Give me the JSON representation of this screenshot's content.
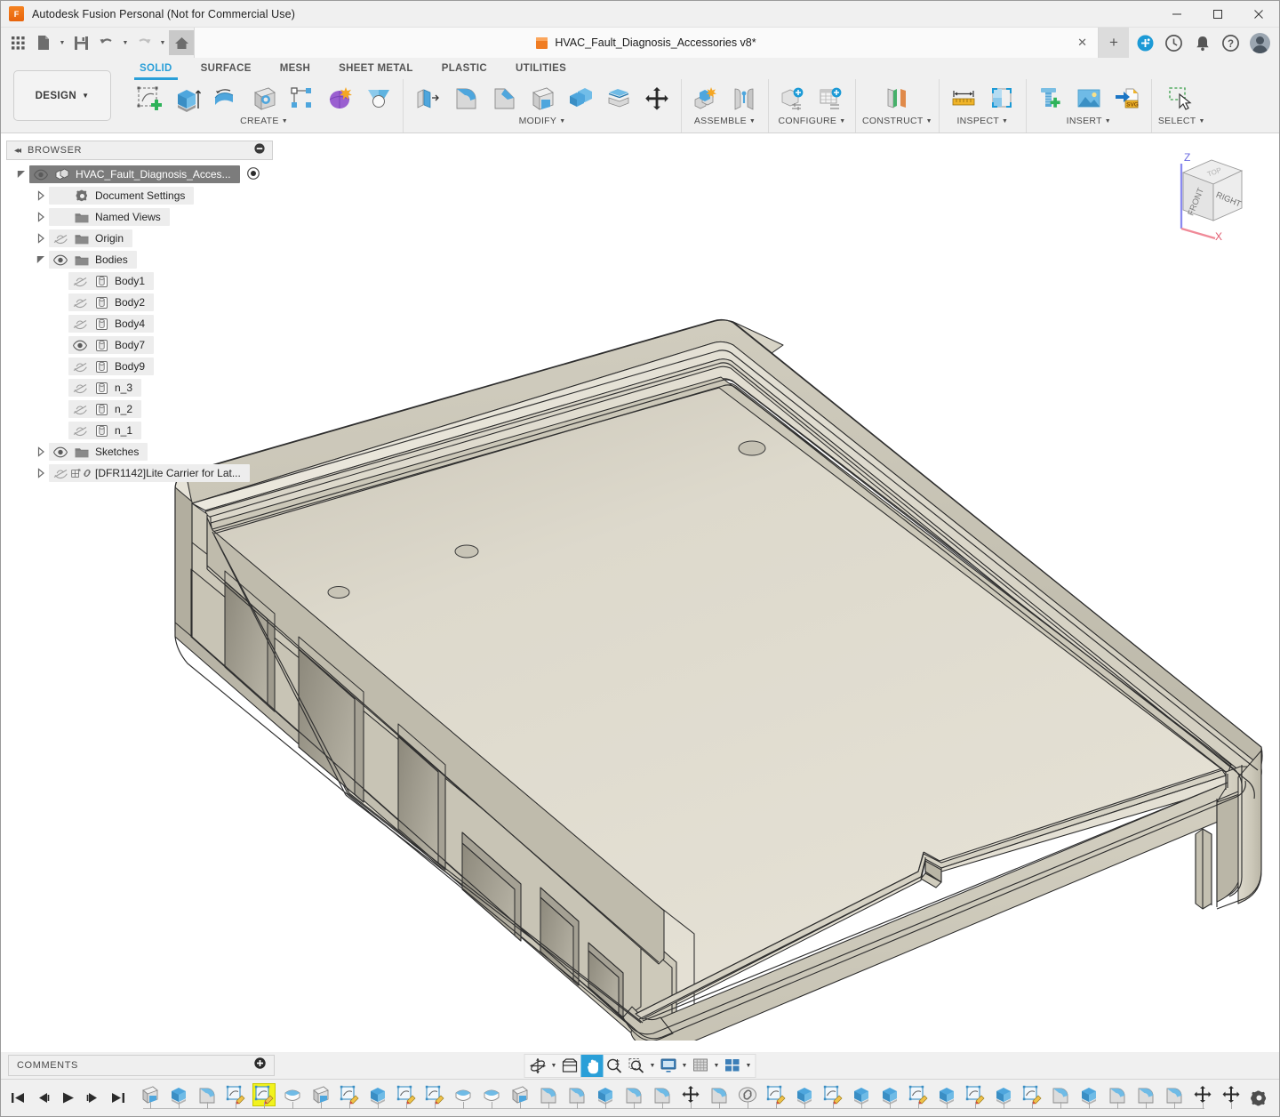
{
  "window": {
    "title": "Autodesk Fusion Personal (Not for Commercial Use)",
    "logo_letter": "F",
    "minimize": "—",
    "maximize": "▢",
    "close": "✕"
  },
  "quick_access": {
    "items": [
      {
        "name": "app-grid-icon",
        "label": "Show Data Panel"
      },
      {
        "name": "file-icon",
        "label": "File"
      },
      {
        "name": "save-icon",
        "label": "Save"
      },
      {
        "name": "undo-icon",
        "label": "Undo"
      },
      {
        "name": "redo-icon",
        "label": "Redo"
      },
      {
        "name": "home-icon",
        "label": "Home"
      }
    ]
  },
  "document_tab": {
    "label": "HVAC_Fault_Diagnosis_Accessories v8*",
    "close_label": "✕",
    "new_tab_label": "+"
  },
  "tray": {
    "items": [
      {
        "name": "extension-manager-icon",
        "label": "Extensions"
      },
      {
        "name": "job-status-icon",
        "label": "Job Status"
      },
      {
        "name": "notifications-bell-icon",
        "label": "Notifications"
      },
      {
        "name": "help-icon",
        "label": "Help"
      },
      {
        "name": "account-avatar",
        "label": "Account"
      }
    ]
  },
  "ribbon": {
    "design_button": "DESIGN",
    "tabs": [
      {
        "label": "SOLID",
        "active": true
      },
      {
        "label": "SURFACE",
        "active": false
      },
      {
        "label": "MESH",
        "active": false
      },
      {
        "label": "SHEET METAL",
        "active": false
      },
      {
        "label": "PLASTIC",
        "active": false
      },
      {
        "label": "UTILITIES",
        "active": false
      }
    ],
    "groups": [
      {
        "label": "CREATE",
        "has_dropdown": true,
        "tools": [
          {
            "name": "create-sketch-icon",
            "label": "Create Sketch"
          },
          {
            "name": "extrude-icon",
            "label": "Extrude"
          },
          {
            "name": "revolve-icon",
            "label": "Revolve"
          },
          {
            "name": "hole-icon",
            "label": "Hole"
          },
          {
            "name": "rectangular-pattern-icon",
            "label": "Rectangular Pattern"
          },
          {
            "name": "form-icon",
            "label": "Create Form"
          },
          {
            "name": "derive-icon",
            "label": "Derive"
          }
        ]
      },
      {
        "label": "MODIFY",
        "has_dropdown": true,
        "tools": [
          {
            "name": "press-pull-icon",
            "label": "Press Pull"
          },
          {
            "name": "fillet-icon",
            "label": "Fillet"
          },
          {
            "name": "chamfer-icon",
            "label": "Chamfer"
          },
          {
            "name": "shell-icon",
            "label": "Shell"
          },
          {
            "name": "combine-icon",
            "label": "Combine"
          },
          {
            "name": "split-face-icon",
            "label": "Split Face"
          },
          {
            "name": "move-copy-icon",
            "label": "Move/Copy"
          }
        ]
      },
      {
        "label": "ASSEMBLE",
        "has_dropdown": true,
        "tools": [
          {
            "name": "new-component-icon",
            "label": "New Component"
          },
          {
            "name": "joint-icon",
            "label": "Joint"
          }
        ]
      },
      {
        "label": "CONFIGURE",
        "has_dropdown": true,
        "tools": [
          {
            "name": "create-configuration-icon",
            "label": "Create Configuration"
          },
          {
            "name": "configuration-table-icon",
            "label": "Configuration Table"
          }
        ]
      },
      {
        "label": "CONSTRUCT",
        "has_dropdown": true,
        "tools": [
          {
            "name": "offset-plane-icon",
            "label": "Offset Plane"
          }
        ]
      },
      {
        "label": "INSPECT",
        "has_dropdown": true,
        "tools": [
          {
            "name": "measure-icon",
            "label": "Measure"
          },
          {
            "name": "section-analysis-icon",
            "label": "Section Analysis"
          }
        ]
      },
      {
        "label": "INSERT",
        "has_dropdown": true,
        "tools": [
          {
            "name": "insert-mcmaster-icon",
            "label": "Insert McMaster-Carr Component"
          },
          {
            "name": "insert-canvas-icon",
            "label": "Canvas"
          },
          {
            "name": "insert-svg-icon",
            "label": "Insert SVG"
          }
        ]
      },
      {
        "label": "SELECT",
        "has_dropdown": true,
        "tools": [
          {
            "name": "select-icon",
            "label": "Select"
          }
        ]
      }
    ]
  },
  "browser": {
    "header": "BROWSER",
    "collapse_icon": "◂◂",
    "tree": [
      {
        "label": "HVAC_Fault_Diagnosis_Acces...",
        "indent": 0,
        "expander": "expanded",
        "visible": true,
        "icon": "component-icon",
        "selected": true,
        "radio": true
      },
      {
        "label": "Document Settings",
        "indent": 1,
        "expander": "collapsed",
        "visible": null,
        "icon": "gear-icon",
        "selected": false
      },
      {
        "label": "Named Views",
        "indent": 1,
        "expander": "collapsed",
        "visible": null,
        "icon": "folder-icon",
        "selected": false
      },
      {
        "label": "Origin",
        "indent": 1,
        "expander": "collapsed",
        "visible": false,
        "icon": "folder-icon",
        "selected": false
      },
      {
        "label": "Bodies",
        "indent": 1,
        "expander": "expanded",
        "visible": true,
        "icon": "folder-icon",
        "selected": false
      },
      {
        "label": "Body1",
        "indent": 2,
        "expander": "none",
        "visible": false,
        "icon": "body-icon",
        "selected": false
      },
      {
        "label": "Body2",
        "indent": 2,
        "expander": "none",
        "visible": false,
        "icon": "body-icon",
        "selected": false
      },
      {
        "label": "Body4",
        "indent": 2,
        "expander": "none",
        "visible": false,
        "icon": "body-icon",
        "selected": false
      },
      {
        "label": "Body7",
        "indent": 2,
        "expander": "none",
        "visible": true,
        "icon": "body-icon",
        "selected": false
      },
      {
        "label": "Body9",
        "indent": 2,
        "expander": "none",
        "visible": false,
        "icon": "body-icon",
        "selected": false
      },
      {
        "label": "n_3",
        "indent": 2,
        "expander": "none",
        "visible": false,
        "icon": "body-icon",
        "selected": false
      },
      {
        "label": "n_2",
        "indent": 2,
        "expander": "none",
        "visible": false,
        "icon": "body-icon",
        "selected": false
      },
      {
        "label": "n_1",
        "indent": 2,
        "expander": "none",
        "visible": false,
        "icon": "body-icon",
        "selected": false
      },
      {
        "label": "Sketches",
        "indent": 1,
        "expander": "collapsed",
        "visible": true,
        "icon": "folder-icon",
        "selected": false
      },
      {
        "label": "[DFR1142]Lite Carrier for Lat...",
        "indent": 1,
        "expander": "collapsed",
        "visible": false,
        "icon": "linked-component-icon",
        "selected": false
      }
    ]
  },
  "viewcube": {
    "front_label": "FRONT",
    "right_label": "RIGHT",
    "top_label": "TOP",
    "axis_z": "Z",
    "axis_x": "X"
  },
  "canvas": {
    "background_color": "#ffffff",
    "model_color": "#dedacd",
    "model_description": "Shaded 3D isometric view of a rectangular open-top enclosure tray with rounded corners, an inner lip ledge, three small circular bosses on the floor, and five rectangular cutouts of varying size along the front-left sidewall"
  },
  "comments": {
    "label": "COMMENTS",
    "add_icon": "+"
  },
  "navbar": {
    "items": [
      {
        "name": "orbit-icon",
        "label": "Orbit",
        "caret": true,
        "active": false
      },
      {
        "name": "look-at-icon",
        "label": "Look At",
        "caret": false,
        "active": false
      },
      {
        "name": "pan-icon",
        "label": "Pan",
        "caret": false,
        "active": true
      },
      {
        "name": "zoom-icon",
        "label": "Zoom",
        "caret": false,
        "active": false
      },
      {
        "name": "fit-icon",
        "label": "Fit",
        "caret": true,
        "active": false
      },
      {
        "name": "display-settings-icon",
        "label": "Display Settings",
        "caret": true,
        "active": false
      },
      {
        "name": "grid-snaps-icon",
        "label": "Grid and Snaps",
        "caret": true,
        "active": false
      },
      {
        "name": "viewports-icon",
        "label": "Viewports",
        "caret": true,
        "active": false
      }
    ]
  },
  "timeline": {
    "playback": [
      {
        "name": "timeline-go-start-button",
        "label": "Go to Beginning"
      },
      {
        "name": "timeline-step-back-button",
        "label": "Step Back"
      },
      {
        "name": "timeline-play-button",
        "label": "Play"
      },
      {
        "name": "timeline-step-forward-button",
        "label": "Step Forward"
      },
      {
        "name": "timeline-go-end-button",
        "label": "Go to End"
      }
    ],
    "features": [
      {
        "type": "shell",
        "selected": false
      },
      {
        "type": "extrude",
        "selected": false
      },
      {
        "type": "fillet",
        "selected": false
      },
      {
        "type": "sketch",
        "selected": false
      },
      {
        "type": "sketch",
        "selected": true
      },
      {
        "type": "revolve",
        "selected": false
      },
      {
        "type": "shell",
        "selected": false
      },
      {
        "type": "sketch",
        "selected": false
      },
      {
        "type": "extrude",
        "selected": false
      },
      {
        "type": "sketch",
        "selected": false
      },
      {
        "type": "sketch",
        "selected": false
      },
      {
        "type": "revolve",
        "selected": false
      },
      {
        "type": "revolve",
        "selected": false
      },
      {
        "type": "shell",
        "selected": false
      },
      {
        "type": "fillet",
        "selected": false
      },
      {
        "type": "fillet",
        "selected": false
      },
      {
        "type": "extrude",
        "selected": false
      },
      {
        "type": "fillet",
        "selected": false
      },
      {
        "type": "fillet",
        "selected": false
      },
      {
        "type": "move",
        "selected": false
      },
      {
        "type": "fillet",
        "selected": false
      },
      {
        "type": "link",
        "selected": false
      },
      {
        "type": "sketch",
        "selected": false
      },
      {
        "type": "extrude",
        "selected": false
      },
      {
        "type": "sketch",
        "selected": false
      },
      {
        "type": "extrude",
        "selected": false
      },
      {
        "type": "extrude",
        "selected": false
      },
      {
        "type": "sketch",
        "selected": false
      },
      {
        "type": "extrude",
        "selected": false
      },
      {
        "type": "sketch",
        "selected": false
      },
      {
        "type": "extrude",
        "selected": false
      },
      {
        "type": "sketch",
        "selected": false
      },
      {
        "type": "fillet",
        "selected": false
      },
      {
        "type": "extrude",
        "selected": false
      },
      {
        "type": "fillet",
        "selected": false
      },
      {
        "type": "fillet",
        "selected": false
      },
      {
        "type": "fillet",
        "selected": false
      },
      {
        "type": "move",
        "selected": false
      },
      {
        "type": "move",
        "selected": false
      },
      {
        "type": "sketch",
        "selected": false
      },
      {
        "type": "extrude",
        "selected": false
      },
      {
        "type": "sketch",
        "selected": false
      },
      {
        "type": "extrude",
        "selected": false
      }
    ],
    "settings_icon": "timeline-settings-gear-icon"
  }
}
